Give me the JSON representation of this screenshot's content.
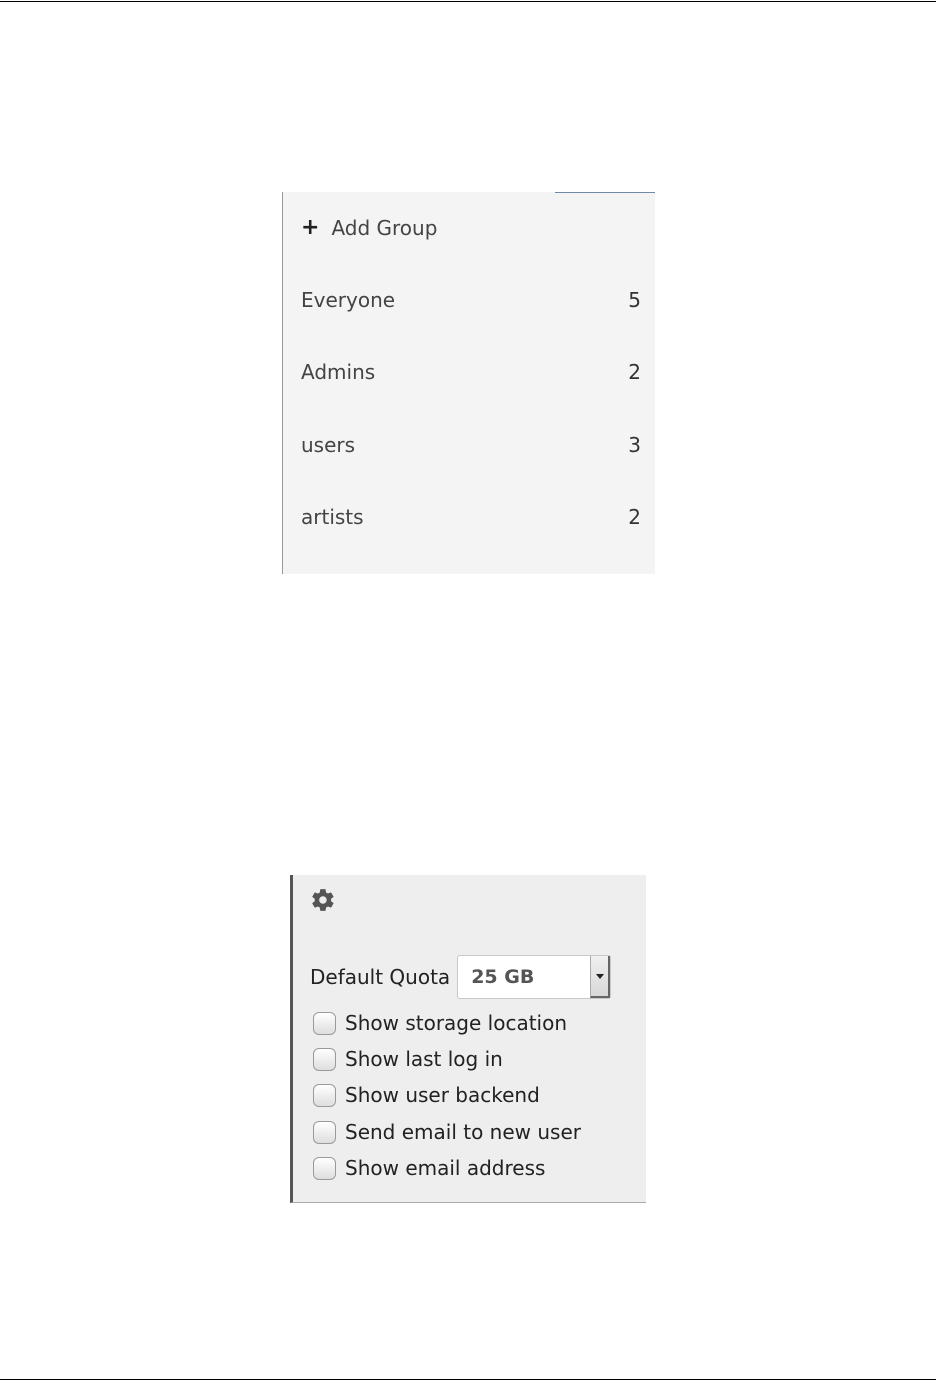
{
  "groups_panel": {
    "add_group": {
      "icon": "plus-icon",
      "label": "Add Group"
    },
    "groups": [
      {
        "name": "Everyone",
        "count": "5"
      },
      {
        "name": "Admins",
        "count": "2"
      },
      {
        "name": "users",
        "count": "3"
      },
      {
        "name": "artists",
        "count": "2"
      }
    ]
  },
  "settings_panel": {
    "icon": "gear-icon",
    "default_quota": {
      "label": "Default Quota",
      "value": "25 GB"
    },
    "options": [
      {
        "label": "Show storage location",
        "checked": false
      },
      {
        "label": "Show last log in",
        "checked": false
      },
      {
        "label": "Show user backend",
        "checked": false
      },
      {
        "label": "Send email to new user",
        "checked": false
      },
      {
        "label": "Show email address",
        "checked": false
      }
    ]
  }
}
